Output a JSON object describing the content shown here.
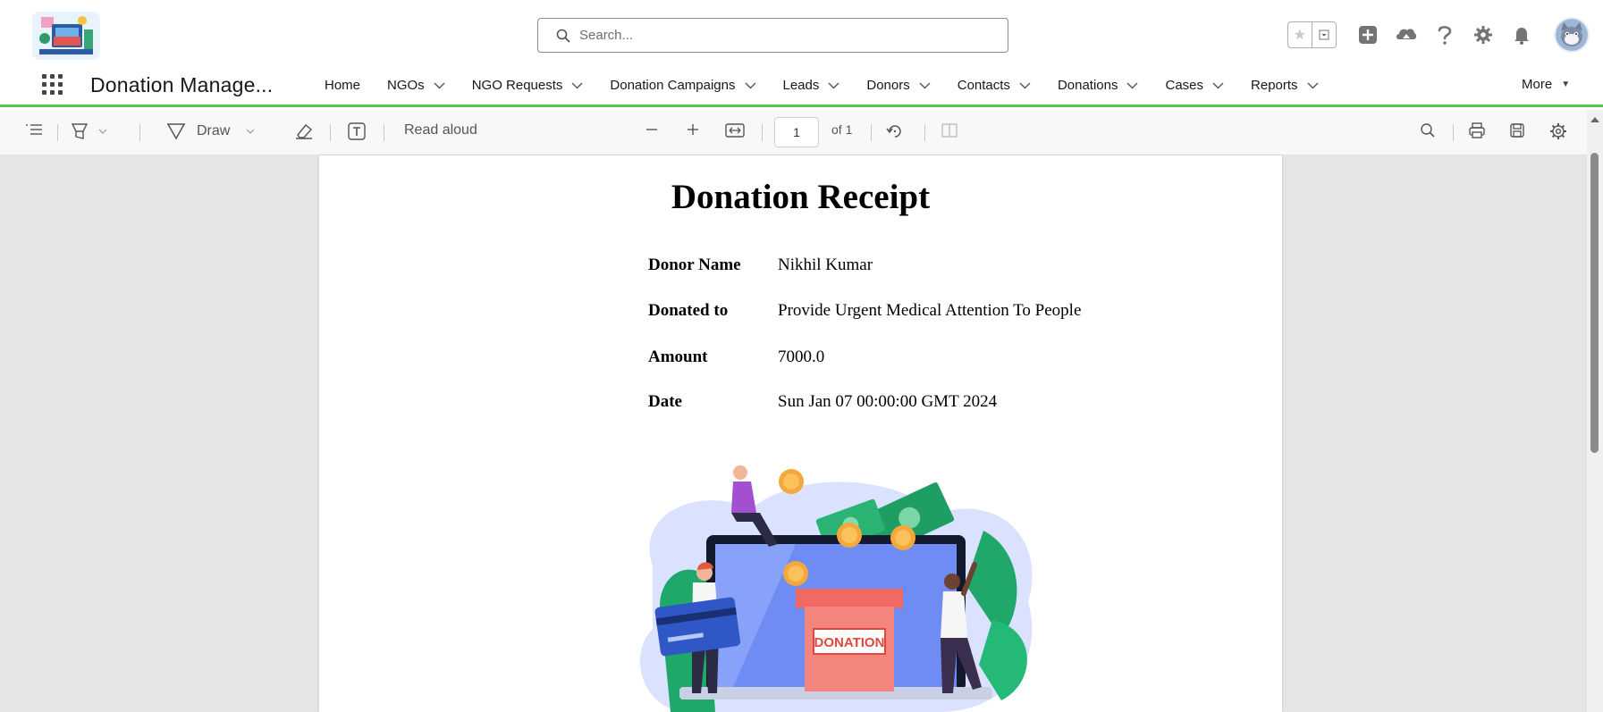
{
  "header": {
    "search_placeholder": "Search...",
    "icons": [
      "favorites-star-icon",
      "favorites-dropdown-icon",
      "global-actions-icon",
      "trailhead-icon",
      "help-icon",
      "setup-gear-icon",
      "notifications-bell-icon",
      "user-avatar"
    ]
  },
  "nav": {
    "app_name": "Donation Manage...",
    "items": [
      {
        "label": "Home",
        "has_menu": false
      },
      {
        "label": "NGOs",
        "has_menu": true
      },
      {
        "label": "NGO Requests",
        "has_menu": true
      },
      {
        "label": "Donation Campaigns",
        "has_menu": true
      },
      {
        "label": "Leads",
        "has_menu": true
      },
      {
        "label": "Donors",
        "has_menu": true
      },
      {
        "label": "Contacts",
        "has_menu": true
      },
      {
        "label": "Donations",
        "has_menu": true
      },
      {
        "label": "Cases",
        "has_menu": true
      },
      {
        "label": "Reports",
        "has_menu": true
      }
    ],
    "more_label": "More",
    "accent_color": "#50c84a"
  },
  "pdf_toolbar": {
    "draw_label": "Draw",
    "read_aloud_label": "Read aloud",
    "page_number": "1",
    "page_total": "of 1"
  },
  "receipt": {
    "title": "Donation Receipt",
    "rows": [
      {
        "label": "Donor Name",
        "value": "Nikhil Kumar"
      },
      {
        "label": "Donated to",
        "value": "Provide Urgent Medical Attention To People"
      },
      {
        "label": "Amount",
        "value": "7000.0"
      },
      {
        "label": "Date",
        "value": "Sun Jan 07 00:00:00 GMT 2024"
      }
    ],
    "illustration_box_label": "DONATION"
  }
}
